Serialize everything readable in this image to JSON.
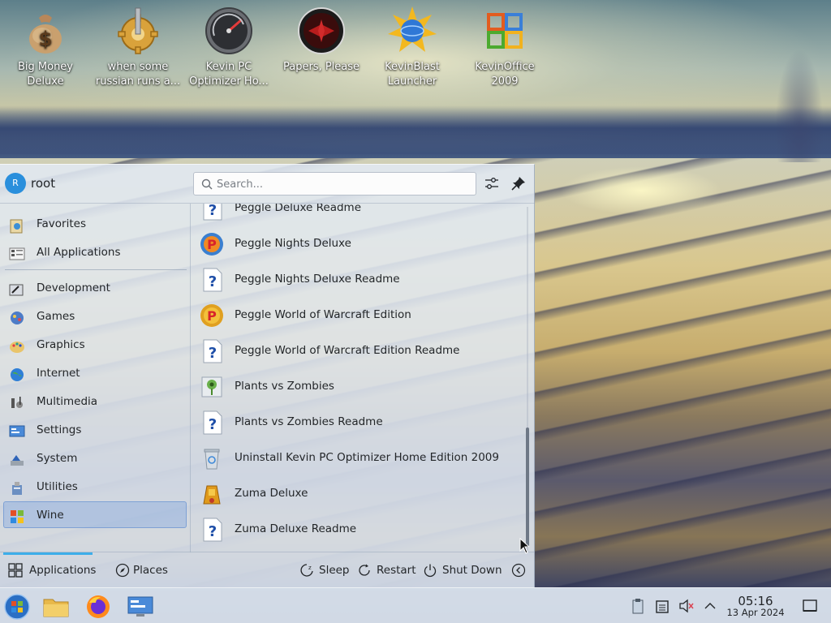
{
  "desktop": {
    "icons": [
      {
        "label": "Big Money Deluxe",
        "icon": "money-bag-icon"
      },
      {
        "label": "when some russian runs a...",
        "icon": "gear-spring-icon"
      },
      {
        "label": "Kevin PC Optimizer Ho...",
        "icon": "speedometer-icon"
      },
      {
        "label": "Papers, Please",
        "icon": "papers-please-icon"
      },
      {
        "label": "KevinBlast Launcher",
        "icon": "sun-globe-icon"
      },
      {
        "label": "KevinOffice 2009",
        "icon": "office-logo-icon"
      }
    ]
  },
  "menu": {
    "user": {
      "initial": "R",
      "name": "root"
    },
    "search": {
      "placeholder": "Search..."
    },
    "header_buttons": [
      "configure-icon",
      "pin-icon"
    ],
    "categories": [
      {
        "label": "Favorites",
        "icon": "favorites-icon"
      },
      {
        "label": "All Applications",
        "icon": "all-applications-icon"
      },
      {
        "label": "Development",
        "icon": "development-icon"
      },
      {
        "label": "Games",
        "icon": "games-icon"
      },
      {
        "label": "Graphics",
        "icon": "graphics-icon"
      },
      {
        "label": "Internet",
        "icon": "internet-icon"
      },
      {
        "label": "Multimedia",
        "icon": "multimedia-icon"
      },
      {
        "label": "Settings",
        "icon": "settings-icon"
      },
      {
        "label": "System",
        "icon": "system-icon"
      },
      {
        "label": "Utilities",
        "icon": "utilities-icon"
      },
      {
        "label": "Wine",
        "icon": "wine-icon"
      }
    ],
    "selected_category": "Wine",
    "apps": [
      {
        "label": "Peggle Deluxe Readme",
        "icon": "readme-icon"
      },
      {
        "label": "Peggle Nights Deluxe",
        "icon": "peggle-icon"
      },
      {
        "label": "Peggle Nights Deluxe Readme",
        "icon": "readme-icon"
      },
      {
        "label": "Peggle World of Warcraft Edition",
        "icon": "peggle-icon"
      },
      {
        "label": "Peggle World of Warcraft Edition Readme",
        "icon": "readme-icon"
      },
      {
        "label": "Plants vs Zombies",
        "icon": "plants-vs-zombies-icon"
      },
      {
        "label": "Plants vs Zombies Readme",
        "icon": "readme-icon"
      },
      {
        "label": "Uninstall Kevin PC Optimizer Home Edition 2009",
        "icon": "recycle-bin-icon"
      },
      {
        "label": "Zuma Deluxe",
        "icon": "zuma-icon"
      },
      {
        "label": "Zuma Deluxe Readme",
        "icon": "readme-icon"
      }
    ],
    "footer": {
      "tabs": [
        {
          "label": "Applications",
          "icon": "applications-grid-icon",
          "active": true
        },
        {
          "label": "Places",
          "icon": "compass-icon",
          "active": false
        }
      ],
      "power": [
        {
          "label": "Sleep",
          "icon": "sleep-icon"
        },
        {
          "label": "Restart",
          "icon": "restart-icon"
        },
        {
          "label": "Shut Down",
          "icon": "power-icon"
        }
      ],
      "more_icon": "chevron-left-icon"
    }
  },
  "taskbar": {
    "launchers": [
      "start-menu-icon",
      "file-manager-icon",
      "firefox-icon",
      "system-settings-icon"
    ],
    "tray": [
      "clipboard-icon",
      "notes-icon",
      "volume-muted-icon",
      "chevron-up-icon"
    ],
    "clock": {
      "time": "05:16",
      "date": "13 Apr 2024"
    },
    "show_desktop_icon": "show-desktop-icon"
  },
  "colors": {
    "accent": "#3daee9",
    "selection": "#96b2de",
    "text": "#232629"
  }
}
